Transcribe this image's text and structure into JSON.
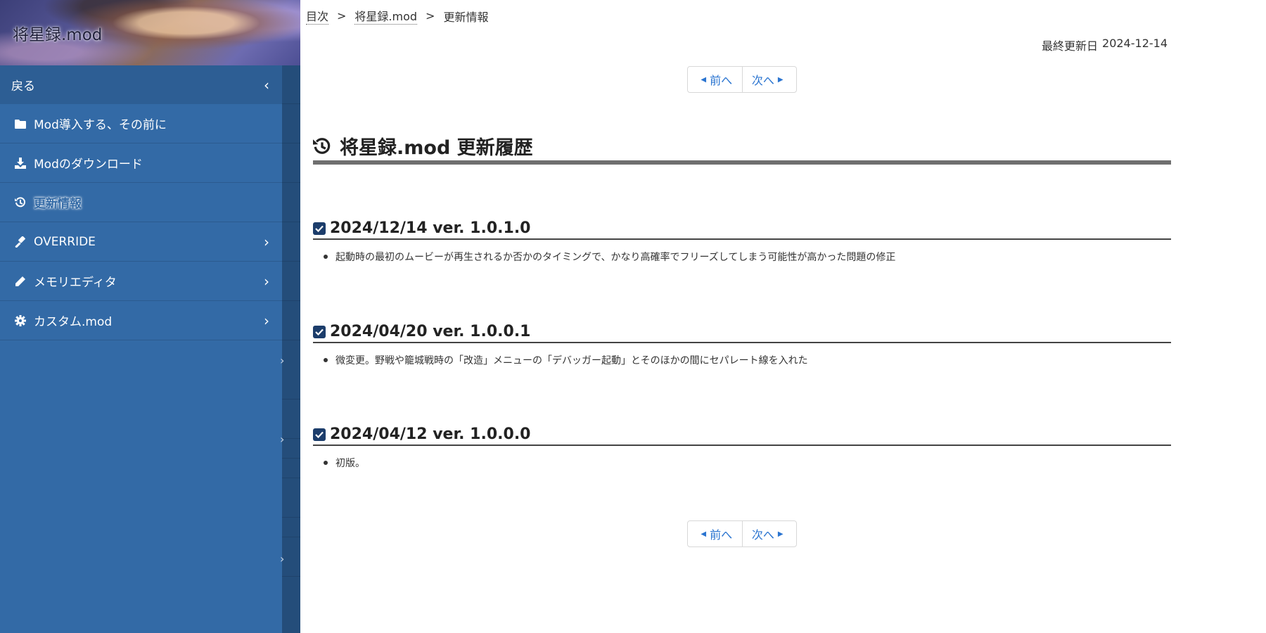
{
  "sidebar": {
    "title": "将星録.mod",
    "back_label": "戻る",
    "items": [
      {
        "label": "Mod導入する、その前に",
        "icon": "folder-icon",
        "has_submenu": false
      },
      {
        "label": "Modのダウンロード",
        "icon": "download-icon",
        "has_submenu": false
      },
      {
        "label": "更新情報",
        "icon": "history-icon",
        "has_submenu": false,
        "active": true
      },
      {
        "label": "OVERRIDE",
        "icon": "gavel-icon",
        "has_submenu": true
      },
      {
        "label": "メモリエディタ",
        "icon": "pencil-icon",
        "has_submenu": true
      },
      {
        "label": "カスタム.mod",
        "icon": "gear-icon",
        "has_submenu": true
      }
    ],
    "colors": {
      "main": "#336aa6",
      "strip": "#244d7a"
    }
  },
  "breadcrumb": {
    "items": [
      "目次",
      "将星録.mod",
      "更新情報"
    ],
    "separator": ">"
  },
  "last_updated": {
    "label": "最終更新日",
    "date": "2024-12-14"
  },
  "pager": {
    "prev": "前へ",
    "next": "次へ"
  },
  "page": {
    "heading": "将星録.mod 更新履歴",
    "heading_icon": "history-icon"
  },
  "entries": [
    {
      "title": "2024/12/14 ver. 1.0.1.0",
      "items": [
        "起動時の最初のムービーが再生されるか否かのタイミングで、かなり高確率でフリーズしてしまう可能性が高かった問題の修正"
      ]
    },
    {
      "title": "2024/04/20 ver. 1.0.0.1",
      "items": [
        "微変更。野戦や籠城戦時の「改造」メニューの「デバッガー起動」とそのほかの間にセパレート線を入れた"
      ]
    },
    {
      "title": "2024/04/12 ver. 1.0.0.0",
      "items": [
        "初版。"
      ]
    }
  ],
  "accent_color": "#2a74d0"
}
